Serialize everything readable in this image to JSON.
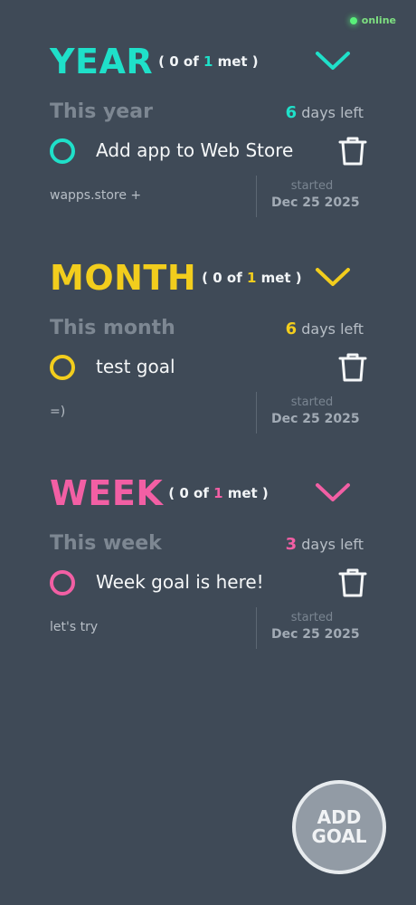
{
  "status": {
    "label": "online"
  },
  "colors": {
    "year": "#1fe0c9",
    "month": "#f2cd1d",
    "week": "#f25fa4",
    "background": "#3f4a57"
  },
  "sections": {
    "year": {
      "title": "YEAR",
      "met_open": "( 0 of ",
      "met_count": "1",
      "met_close": " met )",
      "period": "This year",
      "days_num": "6",
      "days_text": "days left",
      "goal": {
        "text": "Add app to Web Store",
        "note": "wapps.store +",
        "started_label": "started",
        "started_date": "Dec 25 2025"
      }
    },
    "month": {
      "title": "MONTH",
      "met_open": "( 0 of ",
      "met_count": "1",
      "met_close": " met )",
      "period": "This month",
      "days_num": "6",
      "days_text": "days left",
      "goal": {
        "text": "test goal",
        "note": "=)",
        "started_label": "started",
        "started_date": "Dec 25 2025"
      }
    },
    "week": {
      "title": "WEEK",
      "met_open": "( 0 of ",
      "met_count": "1",
      "met_close": " met )",
      "period": "This week",
      "days_num": "3",
      "days_text": "days left",
      "goal": {
        "text": "Week goal is here!",
        "note": "let's try",
        "started_label": "started",
        "started_date": "Dec 25 2025"
      }
    }
  },
  "add_goal": {
    "line1": "ADD",
    "line2": "GOAL"
  }
}
